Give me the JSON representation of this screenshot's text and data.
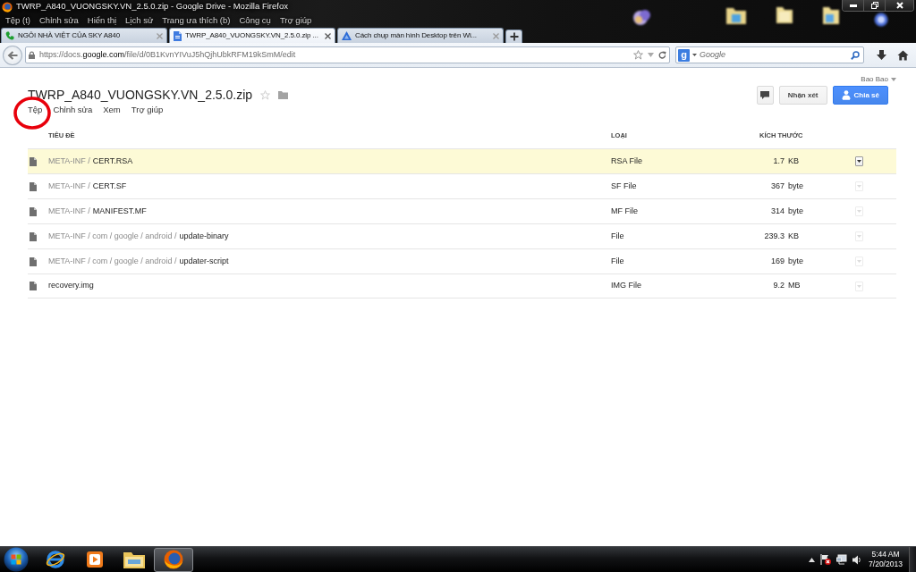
{
  "window": {
    "title": "TWRP_A840_VUONGSKY.VN_2.5.0.zip - Google Drive - Mozilla Firefox"
  },
  "menu_bar": [
    "Tệp (t)",
    "Chỉnh sửa",
    "Hiển thị",
    "Lịch sử",
    "Trang ưa thích (b)",
    "Công cụ",
    "Trợ giúp"
  ],
  "tabs": [
    {
      "kind": "phone",
      "title": "NGÔI NHÀ VIỆT CỦA SKY A840",
      "selected": false
    },
    {
      "kind": "document",
      "title": "TWRP_A840_VUONGSKY.VN_2.5.0.zip ...",
      "selected": true
    },
    {
      "kind": "triangle",
      "title": "Cách chụp màn hình Desktop trên Wi...",
      "selected": false
    }
  ],
  "address_bar": {
    "scheme": "https://docs.",
    "domain": "google.com",
    "path": "/file/d/0B1KvnYIVuJ5hQjhUbkRFM19kSmM/edit"
  },
  "search": {
    "engine_badge": "g",
    "placeholder": "Google"
  },
  "drive": {
    "user": "Bao Bao",
    "title": "TWRP_A840_VUONGSKY.VN_2.5.0.zip",
    "starred": false,
    "buttons": [
      {
        "kind": "comment"
      },
      {
        "kind": "plain",
        "label": "Nhận xét"
      },
      {
        "kind": "share",
        "label": "Chia sẻ"
      }
    ],
    "menu": [
      {
        "label": "Tệp",
        "circled": true
      },
      {
        "label": "Chỉnh sửa",
        "circled": false
      },
      {
        "label": "Xem",
        "circled": false
      },
      {
        "label": "Trợ giúp",
        "circled": false
      }
    ]
  },
  "table": {
    "columns": [
      "TIÊU ĐỀ",
      "LOẠI",
      "KÍCH THƯỚC"
    ],
    "rows": [
      {
        "folder": "META-INF /",
        "name": "CERT.RSA",
        "type": "RSA File",
        "size": "1.7",
        "unit": "KB",
        "selected": true
      },
      {
        "folder": "META-INF /",
        "name": "CERT.SF",
        "type": "SF File",
        "size": "367",
        "unit": "byte",
        "selected": false
      },
      {
        "folder": "META-INF /",
        "name": "MANIFEST.MF",
        "type": "MF File",
        "size": "314",
        "unit": "byte",
        "selected": false
      },
      {
        "folder": "META-INF / com / google / android /",
        "name": "update-binary",
        "type": "File",
        "size": "239.3",
        "unit": "KB",
        "selected": false
      },
      {
        "folder": "META-INF / com / google / android /",
        "name": "updater-script",
        "type": "File",
        "size": "169",
        "unit": "byte",
        "selected": false
      },
      {
        "name": "recovery.img",
        "type": "IMG File",
        "size": "9.2",
        "unit": "MB",
        "selected": false
      }
    ]
  },
  "taskbar": {
    "apps": [
      {
        "kind": "ie",
        "selected": false
      },
      {
        "kind": "media",
        "selected": false
      },
      {
        "kind": "explorer",
        "selected": false
      },
      {
        "kind": "firefox",
        "selected": true
      }
    ],
    "clock": {
      "time": "5:44 AM",
      "date": "7/20/2013"
    }
  }
}
